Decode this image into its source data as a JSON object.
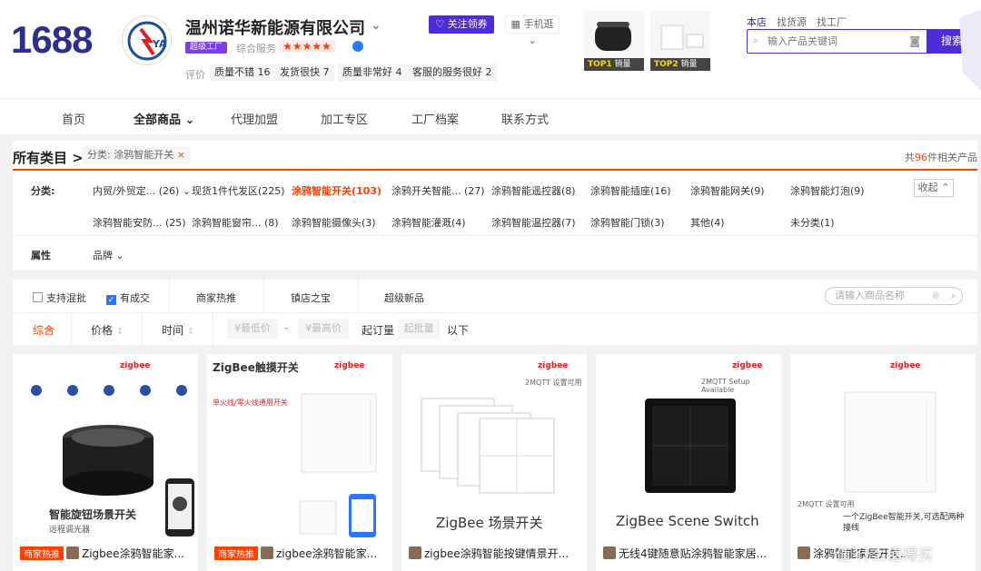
{
  "header": {
    "site_logo": "1688",
    "shop_name": "温州诺华新能源有限公司",
    "factory_badge": "超级工厂",
    "score_label": "综合服务",
    "stars": "★★★★★",
    "review_label": "评价",
    "review_tags": [
      "质量不错 16",
      "发货很快 7",
      "质量非常好 4",
      "客服的服务很好 2"
    ],
    "follow_label": "关注领券",
    "mobile_label": "手机逛",
    "top_products": [
      {
        "rank": "TOP1",
        "label": "销量"
      },
      {
        "rank": "TOP2",
        "label": "销量"
      }
    ],
    "search_tabs": [
      "本店",
      "找货源",
      "找工厂"
    ],
    "search_placeholder": "输入产品关键词",
    "search_button": "搜索"
  },
  "nav": {
    "items": [
      "首页",
      "全部商品",
      "代理加盟",
      "加工专区",
      "工厂档案",
      "联系方式"
    ]
  },
  "category": {
    "title": "所有类目",
    "breadcrumb_tag": "分类: 涂鸦智能开关",
    "count_prefix": "共",
    "count": "96",
    "count_suffix": "件相关产品",
    "label": "分类:",
    "row1": [
      {
        "name": "内贸/外贸定...",
        "count": "(26)"
      },
      {
        "name": "现货1件代发区",
        "count": "(225)"
      },
      {
        "name": "涂鸦智能开关",
        "count": "(103)"
      },
      {
        "name": "涂鸦开关智能...",
        "count": "(27)"
      },
      {
        "name": "涂鸦智能遥控器",
        "count": "(8)"
      },
      {
        "name": "涂鸦智能插座",
        "count": "(16)"
      },
      {
        "name": "涂鸦智能网关",
        "count": "(9)"
      },
      {
        "name": "涂鸦智能灯泡",
        "count": "(9)"
      }
    ],
    "row2": [
      {
        "name": "涂鸦智能安防...",
        "count": "(25)"
      },
      {
        "name": "涂鸦智能窗帘...",
        "count": "(8)"
      },
      {
        "name": "涂鸦智能摄像头",
        "count": "(3)"
      },
      {
        "name": "涂鸦智能灌溉",
        "count": "(4)"
      },
      {
        "name": "涂鸦智能温控器",
        "count": "(7)"
      },
      {
        "name": "涂鸦智能门锁",
        "count": "(3)"
      },
      {
        "name": "其他",
        "count": "(4)"
      },
      {
        "name": "未分类",
        "count": "(1)"
      }
    ],
    "collapse_label": "收起",
    "attr_label": "属性",
    "brand_label": "品牌"
  },
  "filters": {
    "checkboxes": [
      {
        "label": "支持混批",
        "checked": false
      },
      {
        "label": "有成交",
        "checked": true
      }
    ],
    "tabs": [
      "商家热推",
      "镇店之宝",
      "超级新品"
    ],
    "name_search_placeholder": "请输入商品名称",
    "sort": [
      "综合",
      "价格",
      "时间"
    ],
    "price_min_placeholder": "¥最低价",
    "price_max_placeholder": "¥最高价",
    "moq_label": "起订量",
    "moq_placeholder": "起批量",
    "below_label": "以下"
  },
  "products": [
    {
      "hot": "商家热推",
      "title": "Zigbee涂鸦智能家...",
      "img_text": "智能旋钮场景开关",
      "img_sub": "远程调光器",
      "brand": "zigbee"
    },
    {
      "hot": "商家热推",
      "title": "zigbee涂鸦智能家...",
      "img_text": "ZigBee触摸开关",
      "img_sub": "单火线/零火线通用开关",
      "brand": "zigbee"
    },
    {
      "hot": "",
      "title": "zigbee涂鸦智能按键情景开...",
      "img_text": "ZigBee 场景开关",
      "img_sub": "2MQTT 设置可用",
      "brand": "zigbee"
    },
    {
      "hot": "",
      "title": "无线4键随意贴涂鸦智能家居...",
      "img_text": "ZigBee Scene Switch",
      "img_sub": "2MQTT Setup Available",
      "brand": "zigbee"
    },
    {
      "hot": "",
      "title": "涂鸦智能家居开关...",
      "img_text": "一个ZigBee智能开关,可选配两种接线",
      "img_sub": "2MQTT 设置可用",
      "brand": "zigbee"
    }
  ],
  "watermark": "值 什么值得买",
  "colors": {
    "brand": "#2d2f8f",
    "accent": "#4e2dd8",
    "hot": "#ff4000"
  }
}
